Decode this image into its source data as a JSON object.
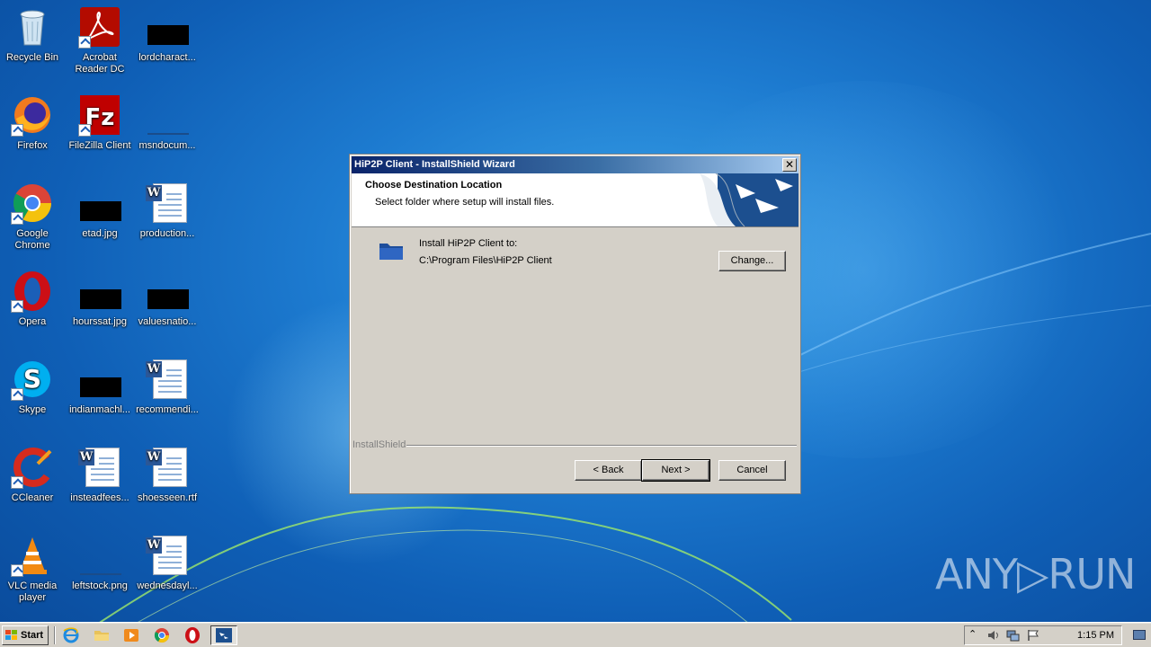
{
  "desktop": {
    "icons": [
      {
        "label": "Recycle Bin",
        "icon": "recycle-bin-icon"
      },
      {
        "label": "Acrobat Reader DC",
        "icon": "acrobat-reader-icon"
      },
      {
        "label": "lordcharact...",
        "icon": "file-thumbnail-icon"
      },
      {
        "label": "Firefox",
        "icon": "firefox-icon"
      },
      {
        "label": "FileZilla Client",
        "icon": "filezilla-icon"
      },
      {
        "label": "msndocum...",
        "icon": "file-thumbnail-icon"
      },
      {
        "label": "Google Chrome",
        "icon": "chrome-icon"
      },
      {
        "label": "etad.jpg",
        "icon": "image-file-icon"
      },
      {
        "label": "production...",
        "icon": "word-document-icon"
      },
      {
        "label": "Opera",
        "icon": "opera-icon"
      },
      {
        "label": "hourssat.jpg",
        "icon": "image-file-icon"
      },
      {
        "label": "valuesnatio...",
        "icon": "file-thumbnail-icon"
      },
      {
        "label": "Skype",
        "icon": "skype-icon"
      },
      {
        "label": "indianmachl...",
        "icon": "file-thumbnail-icon"
      },
      {
        "label": "recommendi...",
        "icon": "word-document-icon"
      },
      {
        "label": "CCleaner",
        "icon": "ccleaner-icon"
      },
      {
        "label": "insteadfees...",
        "icon": "word-document-icon"
      },
      {
        "label": "shoesseen.rtf",
        "icon": "word-document-icon"
      },
      {
        "label": "VLC media player",
        "icon": "vlc-icon"
      },
      {
        "label": "leftstock.png",
        "icon": "image-file-icon"
      },
      {
        "label": "wednesdayl...",
        "icon": "word-document-icon"
      }
    ]
  },
  "dialog": {
    "title": "HiP2P Client - InstallShield Wizard",
    "close_label": "✕",
    "header_title": "Choose Destination Location",
    "header_subtitle": "Select folder where setup will install files.",
    "install_label": "Install HiP2P Client to:",
    "install_path": "C:\\Program Files\\HiP2P Client",
    "change_button": "Change...",
    "brand_label": "InstallShield",
    "back_button": "< Back",
    "next_button": "Next >",
    "cancel_button": "Cancel"
  },
  "taskbar": {
    "start_label": "Start",
    "clock": "1:15 PM",
    "quicklaunch": [
      "internet-explorer-icon",
      "folder-icon",
      "media-player-icon",
      "chrome-icon",
      "opera-icon"
    ],
    "active_task_icon": "installshield-icon"
  },
  "watermark": {
    "text": "ANY▷RUN"
  }
}
